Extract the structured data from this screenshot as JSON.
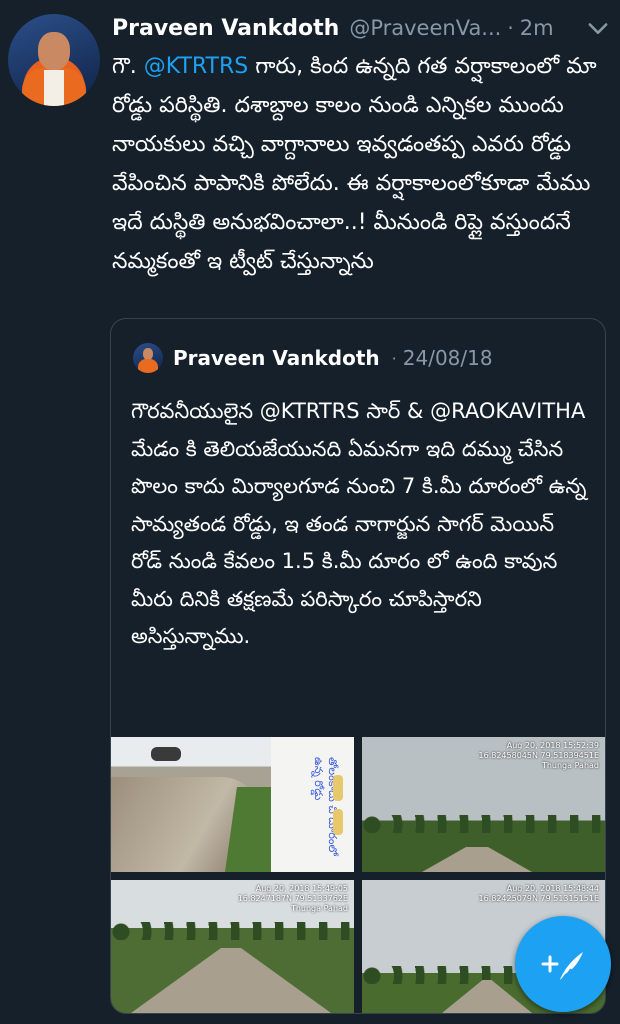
{
  "tweet": {
    "author_name": "Praveen Vankdoth",
    "author_handle": "@PraveenVa...",
    "separator": "·",
    "time_ago": "2m",
    "text_prefix": "గౌ. ",
    "mention": "@KTRTRS",
    "text_body": " గారు, కింద ఉన్నది గత వర్షాకాలంలో మా రోడ్డు పరిస్థితి. దశాబ్దాల కాలం నుండి ఎన్నికల ముందు నాయకులు వచ్చి వాగ్దానాలు ఇవ్వడంతప్ప ఎవరు రోడ్డు వేపించిన పాపానికి పోలేదు. ఈ వర్షాకాలంలోకూడా మేము ఇదే దుస్థితి అనుభవించాలా..! మీనుండి రిప్లై వస్తుందనే నమ్మకంతో ఇ ట్వీట్ చేస్తున్నాను"
  },
  "quoted_tweet": {
    "author_name": "Praveen Vankdoth",
    "separator": "·",
    "date": "24/08/18",
    "text": "గౌరవనీయులైన @KTRTRS సార్ & @RAOKAVITHA మేడం కి తెలియజేయునది ఏమనగా ఇది దమ్ము చేసిన పొలం కాదు మిర్యాలగూడ నుంచి 7 కి.మీ దూరంలో ఉన్న సామ్యతండ రోడ్డు, ఇ తండ నాగార్జున సాగర్ మెయిన్ రోడ్ నుండి కేవలం 1.5 కి.మీ దూరం లో ఉంది కావున మీరు దినికి తక్షణమే పరిస్కారం చూపిస్తారని అసిస్తున్నాము.",
    "photos": [
      {
        "id": "photo-1",
        "overlay_text": "తోలంకాదు  చి దూరంలో ఉన్న  రోడ్డు"
      },
      {
        "id": "photo-2",
        "stamp_line1": "Aug 20, 2018 15:52:39",
        "stamp_line2": "16.82458045N 79.51839451E",
        "stamp_line3": "Thunga Pahad"
      },
      {
        "id": "photo-3",
        "stamp_line1": "Aug 20, 2018 15:49:05",
        "stamp_line2": "16.8247187N 79.5133762E",
        "stamp_line3": "Thunga Pahad"
      },
      {
        "id": "photo-4",
        "stamp_line1": "Aug 20, 2018 15:48:44",
        "stamp_line2": "16.82425079N 79.51315151E",
        "stamp_line3": ""
      }
    ]
  },
  "icons": {
    "chevron": "chevron-down-icon",
    "compose": "compose-tweet-icon"
  },
  "colors": {
    "background": "#15202b",
    "link": "#1da1f2",
    "secondary_text": "#8899a6",
    "border": "#38444d",
    "fab": "#1da1f2"
  }
}
